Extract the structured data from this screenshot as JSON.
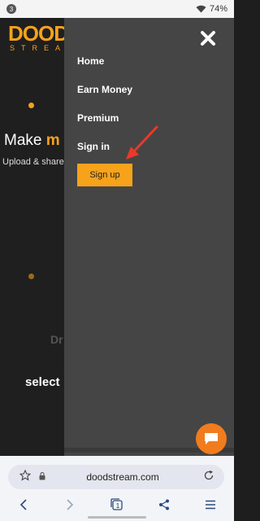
{
  "status_bar": {
    "notif_count": "3",
    "battery": "74%",
    "wifi_icon": "wifi-icon"
  },
  "site": {
    "logo_text": "DOOD",
    "logo_sub": "STREA",
    "hero_title_prefix": "Make ",
    "hero_title_accent": "m",
    "hero_sub": "Upload & share",
    "drop_text": "Dr",
    "select_text": "select"
  },
  "menu": {
    "close_icon": "close-icon",
    "items": [
      {
        "label": "Home"
      },
      {
        "label": "Earn Money"
      },
      {
        "label": "Premium"
      },
      {
        "label": "Sign in"
      }
    ],
    "signup_label": "Sign up",
    "accent_color": "#f7a21b",
    "annotation": "red-arrow"
  },
  "chat": {
    "icon": "chat-bubble-icon",
    "color": "#f07c1e"
  },
  "browser": {
    "url": "doodstream.com",
    "tab_count": "1",
    "icons": [
      "bookmark-star-icon",
      "lock-icon",
      "reload-icon",
      "back-icon",
      "forward-icon",
      "tabs-icon",
      "share-icon",
      "menu-icon"
    ]
  }
}
